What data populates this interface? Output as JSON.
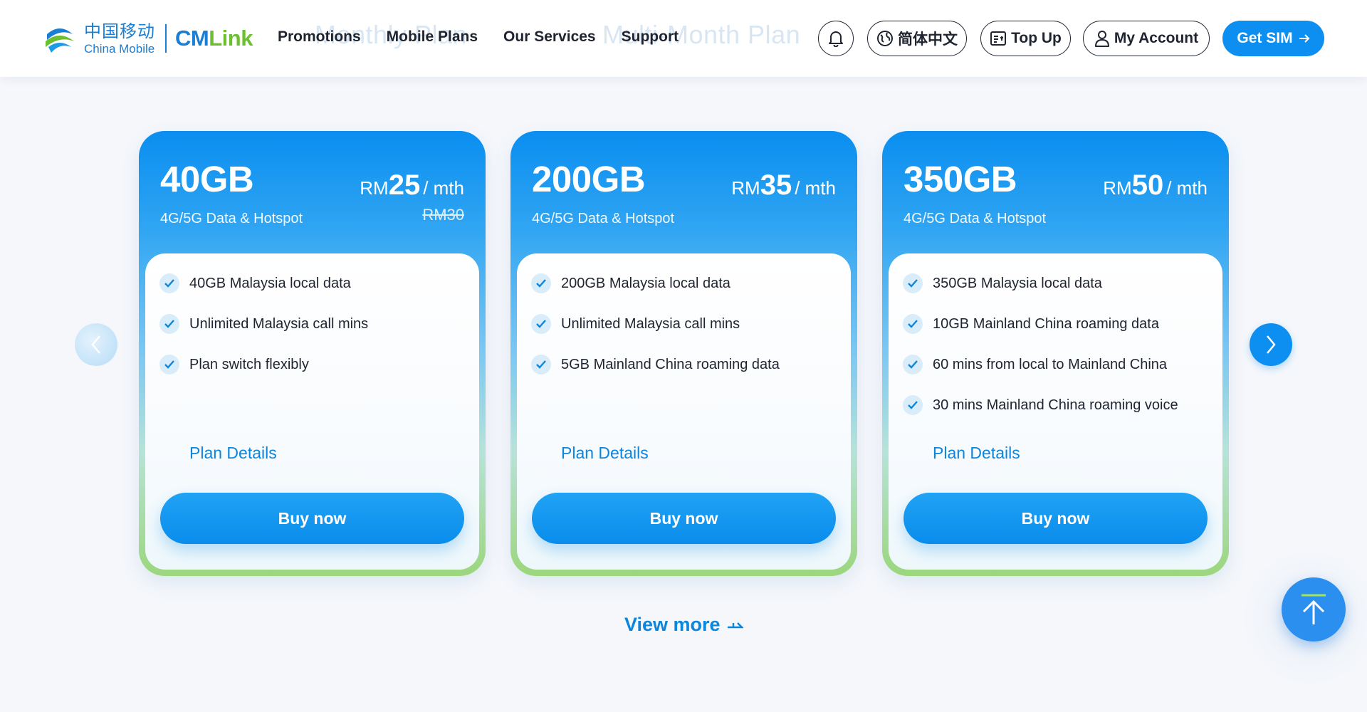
{
  "header": {
    "logo": {
      "cn_text": "中国移动",
      "en_text": "China Mobile",
      "brand_cm": "CM",
      "brand_link": "Link"
    },
    "ghost_tabs": [
      "Monthly Plan",
      "Multi-Month Plan"
    ],
    "nav": [
      {
        "label": "Promotions"
      },
      {
        "label": "Mobile Plans"
      },
      {
        "label": "Our Services"
      },
      {
        "label": "Support"
      }
    ],
    "notification_icon": "bell-icon",
    "language_label": "简体中文",
    "topup_label": "Top Up",
    "account_label": "My Account",
    "getsim_label": "Get SIM"
  },
  "plans": [
    {
      "data": "40GB",
      "subtitle": "4G/5G Data & Hotspot",
      "currency": "RM",
      "price": "25",
      "period": "/ mth",
      "old_price": "RM30",
      "features": [
        "40GB Malaysia local data",
        "Unlimited Malaysia call mins",
        "Plan switch flexibly"
      ],
      "details_label": "Plan Details",
      "buy_label": "Buy now"
    },
    {
      "data": "200GB",
      "subtitle": "4G/5G Data & Hotspot",
      "currency": "RM",
      "price": "35",
      "period": "/ mth",
      "old_price": "",
      "features": [
        "200GB Malaysia local data",
        "Unlimited Malaysia call mins",
        "5GB Mainland China roaming data"
      ],
      "details_label": "Plan Details",
      "buy_label": "Buy now"
    },
    {
      "data": "350GB",
      "subtitle": "4G/5G Data & Hotspot",
      "currency": "RM",
      "price": "50",
      "period": "/ mth",
      "old_price": "",
      "features": [
        "350GB Malaysia local data",
        "10GB Mainland China roaming data",
        "60 mins from local to Mainland China",
        "30 mins Mainland China roaming voice"
      ],
      "details_label": "Plan Details",
      "buy_label": "Buy now"
    }
  ],
  "carousel": {
    "prev_icon": "chevron-left-icon",
    "next_icon": "chevron-right-icon"
  },
  "view_more_label": "View more",
  "back_to_top_icon": "arrow-up-icon",
  "colors": {
    "brand_blue": "#0c8ff0",
    "link_blue": "#0c86dd",
    "brand_green": "#6cbf2f"
  }
}
